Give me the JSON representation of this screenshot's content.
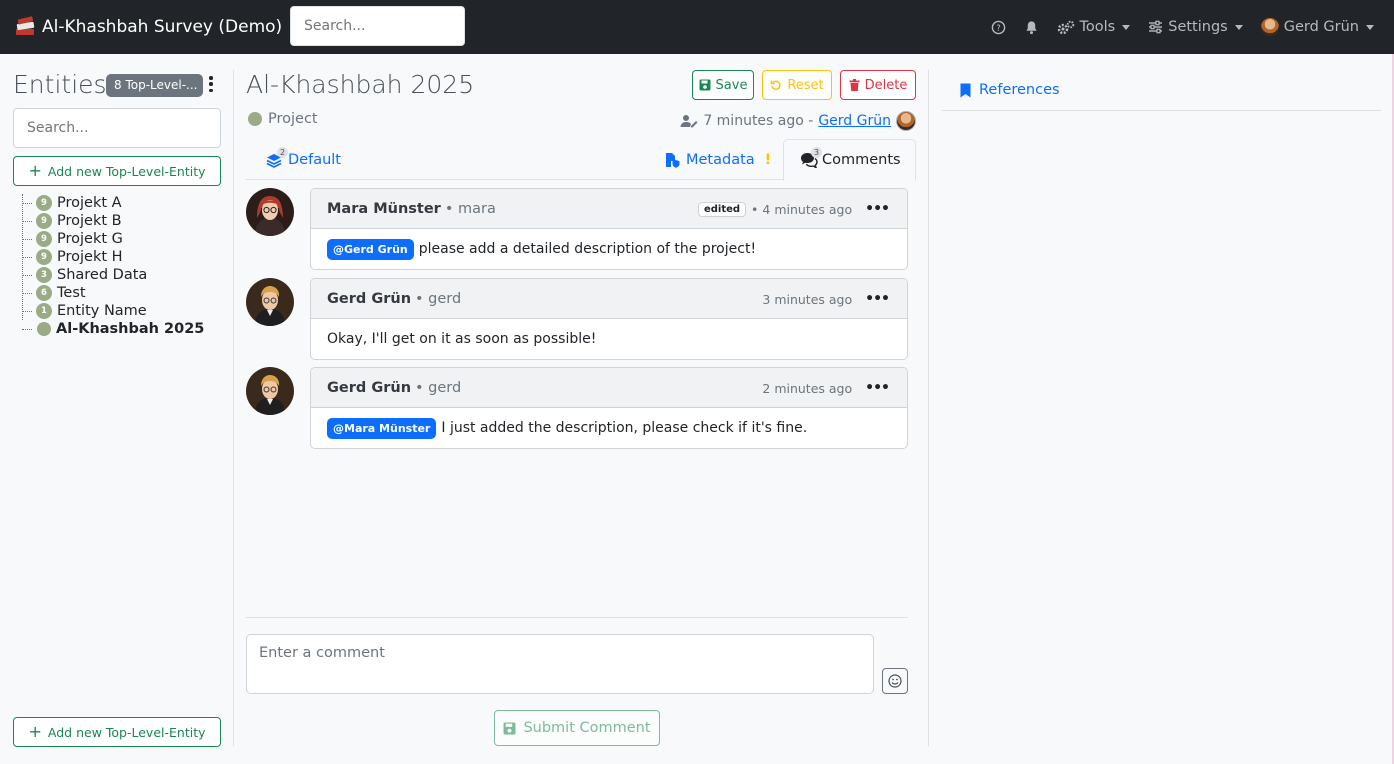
{
  "navbar": {
    "title": "Al-Khashbah Survey (Demo)",
    "search_placeholder": "Search...",
    "tools_label": "Tools",
    "settings_label": "Settings",
    "user_name": "Gerd Grün",
    "icons": [
      "help-icon",
      "bell-icon",
      "gears-icon",
      "sliders-icon"
    ]
  },
  "sidebar": {
    "title": "Entities",
    "badge": "8 Top-Level-...",
    "search_placeholder": "Search...",
    "add_button_top": "Add new Top-Level-Entity",
    "add_button_bottom": "Add new Top-Level-Entity",
    "tree": [
      {
        "count": "9",
        "label": "Projekt A"
      },
      {
        "count": "9",
        "label": "Projekt B"
      },
      {
        "count": "9",
        "label": "Projekt G"
      },
      {
        "count": "9",
        "label": "Projekt H"
      },
      {
        "count": "3",
        "label": "Shared Data"
      },
      {
        "count": "6",
        "label": "Test"
      },
      {
        "count": "1",
        "label": "Entity Name"
      },
      {
        "count": "",
        "label": "Al-Khashbah 2025",
        "active": true
      }
    ]
  },
  "main": {
    "title": "Al-Khashbah 2025",
    "type_label": "Project",
    "save_label": "Save",
    "reset_label": "Reset",
    "delete_label": "Delete",
    "last_edit": "7 minutes ago -",
    "last_editor": "Gerd Grün",
    "tabs": [
      {
        "label": "Default",
        "count": "2"
      },
      {
        "label": "Metadata",
        "warning": "!"
      },
      {
        "label": "Comments",
        "count": "3"
      }
    ],
    "comments": [
      {
        "author": "Mara Münster",
        "username": "• mara",
        "edited": "edited",
        "time": "• 4 minutes ago",
        "mention": "@Gerd Grün",
        "text": "please add a detailed description of the project!"
      },
      {
        "author": "Gerd Grün",
        "username": "• gerd",
        "time": "3 minutes ago",
        "mention": "",
        "text": "Okay, I'll get on it as soon as possible!"
      },
      {
        "author": "Gerd Grün",
        "username": "• gerd",
        "time": "2 minutes ago",
        "mention": "@Mara Münster",
        "text": "I just added the description, please check if it's fine."
      }
    ],
    "comment_placeholder": "Enter a comment",
    "submit_label": "Submit Comment"
  },
  "right": {
    "tab_label": "References"
  },
  "colors": {
    "navbar_bg": "#212529",
    "accent": "#0d6efd",
    "success": "#198754",
    "warning": "#ffc107",
    "danger": "#dc3545",
    "entity_dot": "#9aab86"
  }
}
